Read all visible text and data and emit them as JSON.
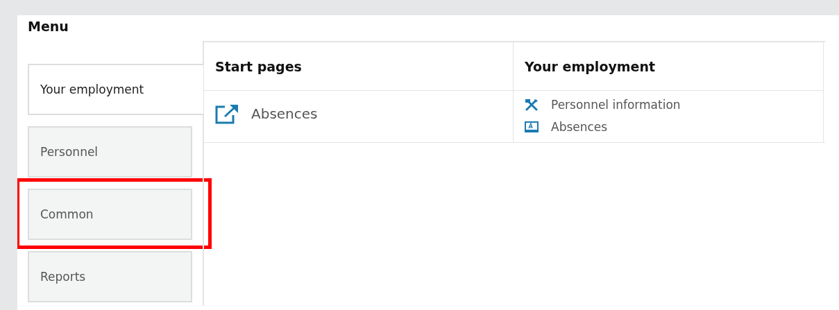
{
  "menu": {
    "title": "Menu",
    "tabs": [
      {
        "label": "Your employment",
        "selected": true,
        "highlighted": false
      },
      {
        "label": "Personnel",
        "selected": false,
        "highlighted": false
      },
      {
        "label": "Common",
        "selected": false,
        "highlighted": true
      },
      {
        "label": "Reports",
        "selected": false,
        "highlighted": false
      }
    ]
  },
  "columns": [
    {
      "heading": "Start pages",
      "links": [
        {
          "label": "Absences",
          "kind": "external"
        }
      ]
    },
    {
      "heading": "Your employment",
      "links": [
        {
          "label": "Personnel information",
          "kind": "tools"
        },
        {
          "label": "Absences",
          "kind": "form"
        }
      ]
    }
  ]
}
